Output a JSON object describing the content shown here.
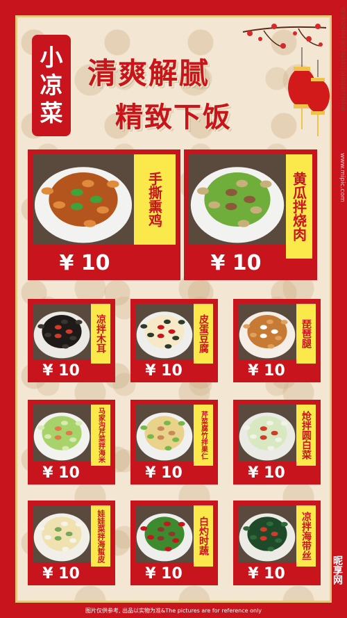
{
  "header": {
    "badge": [
      "小",
      "凉",
      "菜"
    ],
    "title_line1": "清爽解腻",
    "title_line2": "精致下饭"
  },
  "items": [
    {
      "name": "手撕熏鸡",
      "price": "¥ 10",
      "image": "smoked-chicken"
    },
    {
      "name": "黄瓜拌烧肉",
      "price": "¥ 10",
      "image": "cucumber-pork"
    },
    {
      "name": "凉拌木耳",
      "price": "¥ 10",
      "image": "wood-ear"
    },
    {
      "name": "皮蛋豆腐",
      "price": "¥ 10",
      "image": "century-egg-tofu"
    },
    {
      "name": "琵琶腿",
      "price": "¥ 10",
      "image": "drumstick"
    },
    {
      "name": "马家沟芹菜拌海米",
      "price": "¥ 10",
      "image": "celery-shrimp"
    },
    {
      "name": "芹菜腐竹拌果仁",
      "price": "¥ 10",
      "image": "celery-tofu-skin"
    },
    {
      "name": "炝拌圆白菜",
      "price": "¥ 10",
      "image": "cabbage"
    },
    {
      "name": "娃娃菜拌海蜇皮",
      "price": "¥ 10",
      "image": "baby-cabbage-jellyfish"
    },
    {
      "name": "白灼时蔬",
      "price": "¥ 10",
      "image": "greens"
    },
    {
      "name": "凉拌海带丝",
      "price": "¥ 10",
      "image": "kelp"
    }
  ],
  "footer": "图片仅供参考, 出品以实物为准&The pictures are for reference only",
  "watermark": "www.mipic.com",
  "watermark_id": "ID:25525604 NO:20251110102109778106",
  "logo": "昵享网",
  "colors": {
    "red": "#c8141c",
    "yellow": "#fbe84a",
    "bg": "#f3e6d2",
    "gold": "#e7c77a"
  }
}
